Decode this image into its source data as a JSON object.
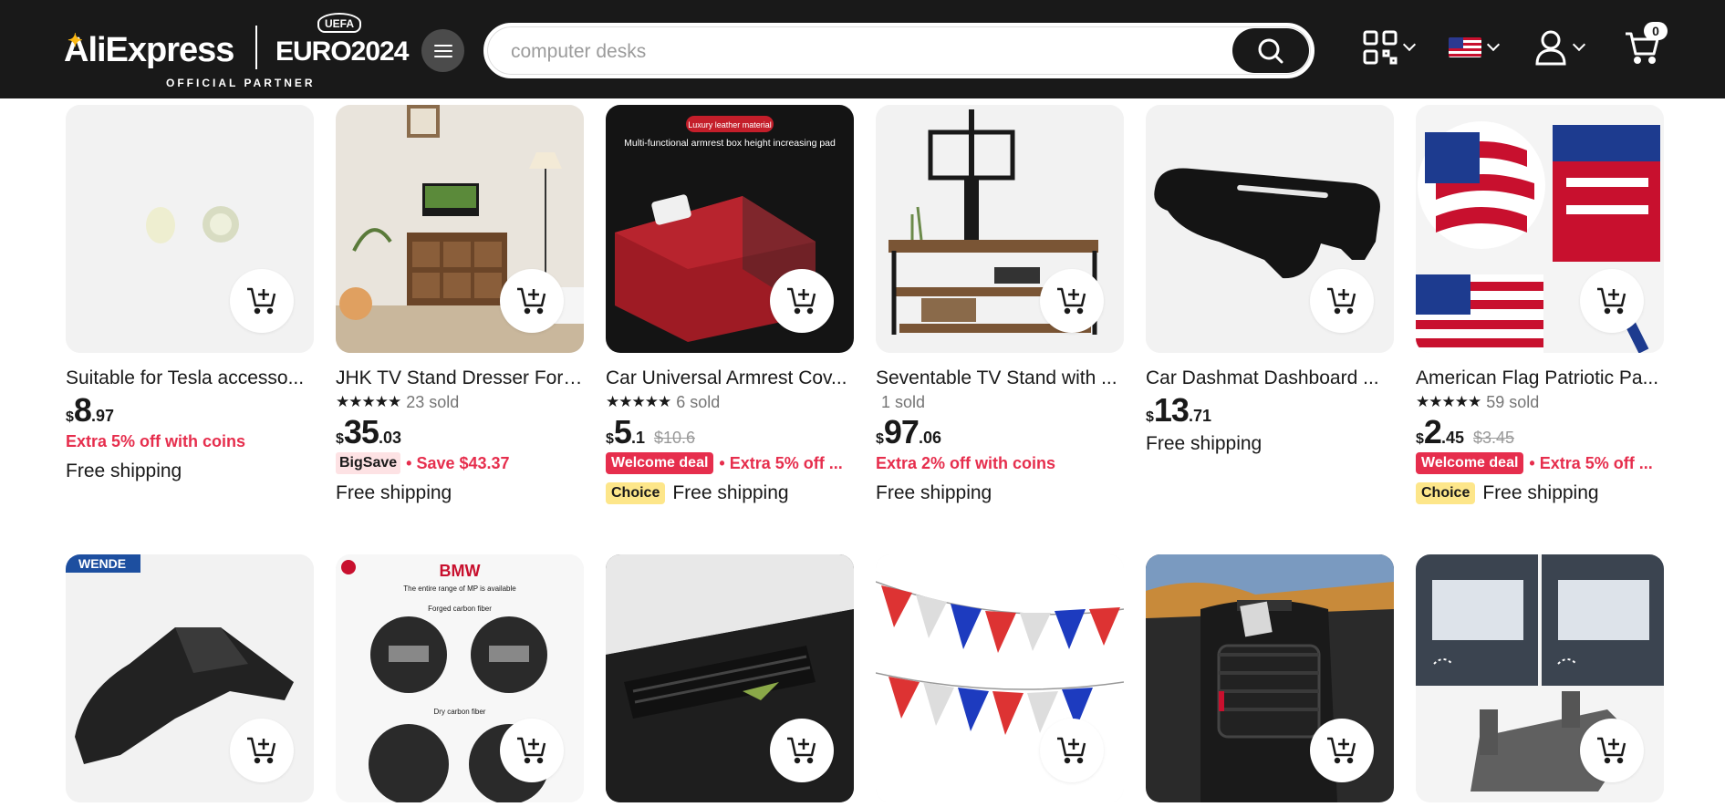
{
  "header": {
    "logo_text": "AliExpress",
    "partner_logo": "EURO2024",
    "partner_badge": "UEFA",
    "official_partner": "OFFICIAL PARTNER",
    "menu_icon": "hamburger-icon",
    "search_placeholder": "computer desks",
    "search_icon": "search-icon",
    "qr_icon": "qr-code-icon",
    "flag_icon": "us-flag-icon",
    "account_icon": "user-icon",
    "cart_icon": "cart-icon",
    "cart_count": "0",
    "bg_color": "#191919"
  },
  "products": [
    {
      "title": "Suitable for Tesla accesso...",
      "rating": "",
      "sold": "",
      "currency": "$",
      "price_int": "8",
      "price_dec": ".97",
      "old_price": "",
      "promo_tag": "",
      "promo_text": "Extra 5% off with coins",
      "choice": "",
      "shipping": "Free shipping"
    },
    {
      "title": "JHK TV Stand Dresser For ...",
      "rating": "★★★★★",
      "sold": "23 sold",
      "currency": "$",
      "price_int": "35",
      "price_dec": ".03",
      "old_price": "",
      "promo_tag": "BigSave",
      "promo_text": "• Save $43.37",
      "choice": "",
      "shipping": "Free shipping"
    },
    {
      "title": "Car Universal Armrest Cov...",
      "rating": "★★★★★",
      "sold": "6 sold",
      "currency": "$",
      "price_int": "5",
      "price_dec": ".1",
      "old_price": "$10.6",
      "promo_tag": "Welcome deal",
      "promo_text": "• Extra 5% off ...",
      "choice": "Choice",
      "shipping": "Free shipping"
    },
    {
      "title": "Seventable TV Stand with ...",
      "rating": "",
      "sold": "1 sold",
      "currency": "$",
      "price_int": "97",
      "price_dec": ".06",
      "old_price": "",
      "promo_tag": "",
      "promo_text": "Extra 2% off with coins",
      "choice": "",
      "shipping": "Free shipping"
    },
    {
      "title": "Car Dashmat Dashboard ...",
      "rating": "",
      "sold": "",
      "currency": "$",
      "price_int": "13",
      "price_dec": ".71",
      "old_price": "",
      "promo_tag": "",
      "promo_text": "",
      "choice": "",
      "shipping": "Free shipping"
    },
    {
      "title": "American Flag Patriotic Pa...",
      "rating": "★★★★★",
      "sold": "59 sold",
      "currency": "$",
      "price_int": "2",
      "price_dec": ".45",
      "old_price": "$3.45",
      "promo_tag": "Welcome deal",
      "promo_text": "• Extra 5% off ...",
      "choice": "Choice",
      "shipping": "Free shipping"
    }
  ],
  "row2": {
    "wende_logo": "WENDE",
    "bmw_title": "BMW",
    "bmw_line1": "The entire range of MP is available",
    "bmw_line2": "Forged carbon fiber",
    "bmw_line3": "Dry carbon fiber",
    "armrest_badge": "Luxury leather material",
    "armrest_heading": "Multi-functional armrest box height increasing pad"
  },
  "add_to_cart_icon": "add-to-cart-icon",
  "colors": {
    "accent_red": "#e62e4d",
    "choice_yellow": "#fde68a",
    "card_bg": "#f2f2f2"
  }
}
